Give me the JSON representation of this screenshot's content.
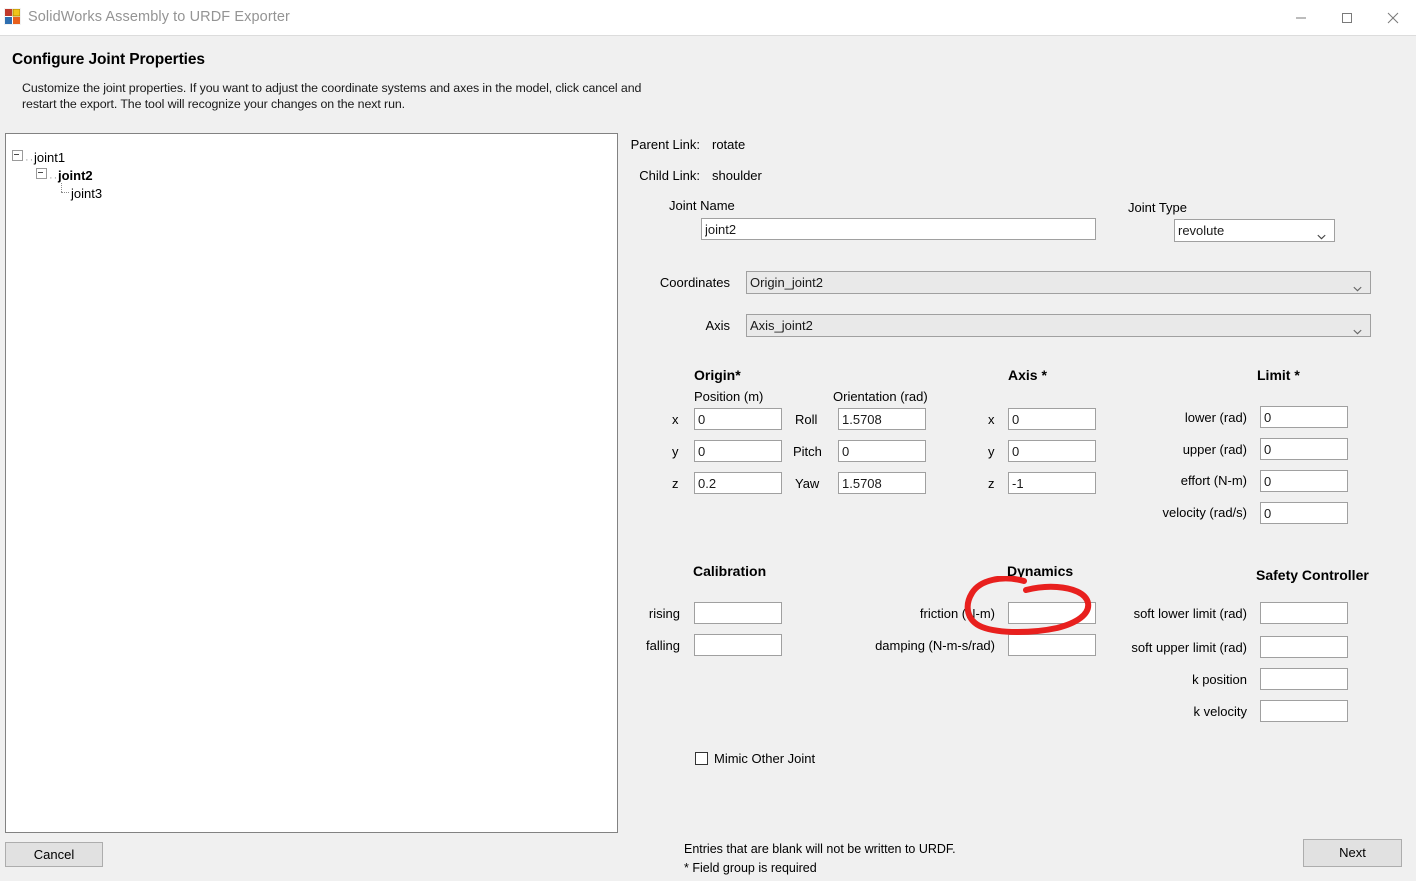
{
  "window": {
    "title": "SolidWorks Assembly to URDF Exporter",
    "icon": "app-grid-icon",
    "minimize_label": "—",
    "maximize_label": "□",
    "close_label": "✕"
  },
  "header": {
    "title": "Configure Joint Properties",
    "subtitle": "Customize the joint properties. If you want to adjust the coordinate systems and axes in the model, click cancel and restart the export. The tool will recognize your changes on the next run."
  },
  "tree": {
    "nodes": [
      {
        "label": "joint1",
        "level": 0,
        "expanded": true,
        "selected": false
      },
      {
        "label": "joint2",
        "level": 1,
        "expanded": true,
        "selected": true
      },
      {
        "label": "joint3",
        "level": 2,
        "expanded": false,
        "selected": false
      }
    ]
  },
  "links": {
    "parent_label": "Parent Link:",
    "parent_value": "rotate",
    "child_label": "Child Link:",
    "child_value": "shoulder"
  },
  "joint_name": {
    "label": "Joint Name",
    "value": "joint2"
  },
  "joint_type": {
    "label": "Joint Type",
    "value": "revolute"
  },
  "coordinates": {
    "label": "Coordinates",
    "value": "Origin_joint2"
  },
  "axis_ref": {
    "label": "Axis",
    "value": "Axis_joint2"
  },
  "origin": {
    "title": "Origin*",
    "position_header": "Position (m)",
    "orientation_header": "Orientation (rad)",
    "x_label": "x",
    "y_label": "y",
    "z_label": "z",
    "x": "0",
    "y": "0",
    "z": "0.2",
    "roll_label": "Roll",
    "pitch_label": "Pitch",
    "yaw_label": "Yaw",
    "roll": "1.5708",
    "pitch": "0",
    "yaw": "1.5708"
  },
  "axis": {
    "title": "Axis *",
    "x_label": "x",
    "y_label": "y",
    "z_label": "z",
    "x": "0",
    "y": "0",
    "z": "-1"
  },
  "limit": {
    "title": "Limit *",
    "lower_label": "lower (rad)",
    "upper_label": "upper (rad)",
    "effort_label": "effort (N-m)",
    "velocity_label": "velocity (rad/s)",
    "lower": "0",
    "upper": "0",
    "effort": "0",
    "velocity": "0"
  },
  "calibration": {
    "title": "Calibration",
    "rising_label": "rising",
    "falling_label": "falling",
    "rising": "",
    "falling": ""
  },
  "dynamics": {
    "title": "Dynamics",
    "friction_label": "friction (N-m)",
    "damping_label": "damping (N-m-s/rad)",
    "friction": "",
    "damping": ""
  },
  "safety": {
    "title": "Safety Controller",
    "soft_lower_label": "soft lower limit (rad)",
    "soft_upper_label": "soft upper limit (rad)",
    "k_position_label": "k position",
    "k_velocity_label": "k velocity",
    "soft_lower": "",
    "soft_upper": "",
    "k_position": "",
    "k_velocity": ""
  },
  "mimic": {
    "label": "Mimic Other Joint",
    "checked": false
  },
  "footer": {
    "note_line1": "Entries that are blank will not be written to URDF.",
    "note_line2": "* Field group is required",
    "cancel_label": "Cancel",
    "next_label": "Next"
  },
  "annotation": {
    "color": "#e8201e",
    "shape": "hand-drawn-ellipse",
    "targets": "axis-z-field"
  }
}
